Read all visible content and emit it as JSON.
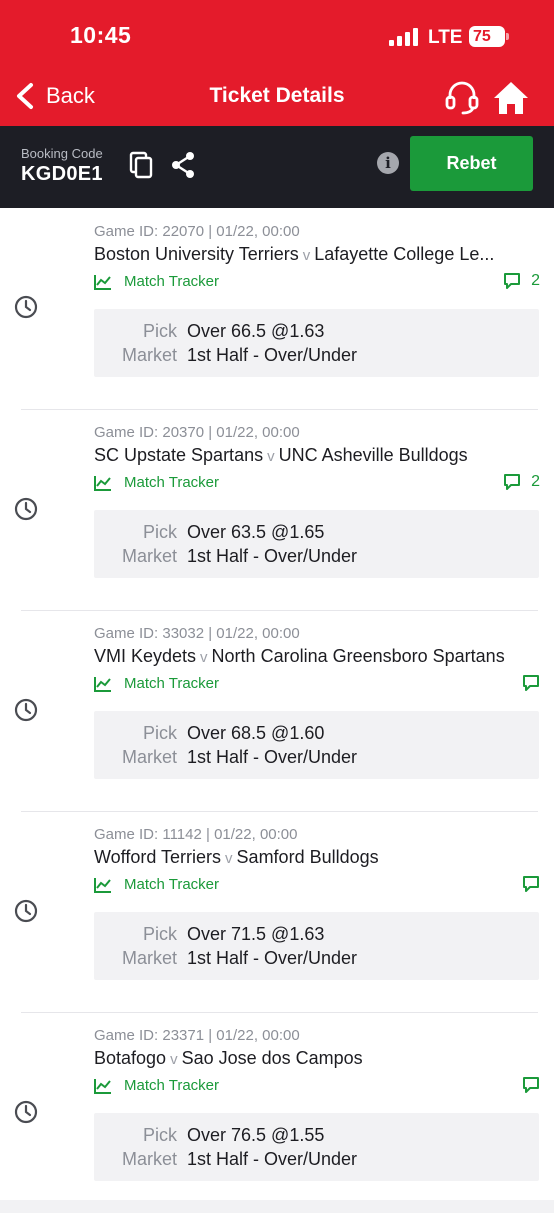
{
  "status": {
    "time": "10:45",
    "network": "LTE",
    "battery": "75"
  },
  "nav": {
    "back_label": "Back",
    "title": "Ticket Details"
  },
  "booking": {
    "label": "Booking Code",
    "code": "KGD0E1",
    "rebet_label": "Rebet"
  },
  "colors": {
    "header_red": "#e41b2b",
    "booking_bar": "#1d1e25",
    "accent_green": "#1b9a3a"
  },
  "games": [
    {
      "meta": "Game ID: 22070 | 01/22, 00:00",
      "home": "Boston University Terriers",
      "vs": "v",
      "away": "Lafayette College Le...",
      "tracker": "Match Tracker",
      "comments": "2",
      "pick_key": "Pick",
      "pick": "Over 66.5 @1.63",
      "market_key": "Market",
      "market": "1st Half - Over/Under"
    },
    {
      "meta": "Game ID: 20370 | 01/22, 00:00",
      "home": "SC Upstate Spartans",
      "vs": "v",
      "away": "UNC Asheville Bulldogs",
      "tracker": "Match Tracker",
      "comments": "2",
      "pick_key": "Pick",
      "pick": "Over 63.5 @1.65",
      "market_key": "Market",
      "market": "1st Half - Over/Under"
    },
    {
      "meta": "Game ID: 33032 | 01/22, 00:00",
      "home": "VMI Keydets",
      "vs": "v",
      "away": "North Carolina Greensboro Spartans",
      "tracker": "Match Tracker",
      "comments": "",
      "pick_key": "Pick",
      "pick": "Over 68.5 @1.60",
      "market_key": "Market",
      "market": "1st Half - Over/Under"
    },
    {
      "meta": "Game ID: 11142 | 01/22, 00:00",
      "home": "Wofford Terriers",
      "vs": "v",
      "away": "Samford Bulldogs",
      "tracker": "Match Tracker",
      "comments": "",
      "pick_key": "Pick",
      "pick": "Over 71.5 @1.63",
      "market_key": "Market",
      "market": "1st Half - Over/Under"
    },
    {
      "meta": "Game ID: 23371 | 01/22, 00:00",
      "home": "Botafogo",
      "vs": "v",
      "away": "Sao Jose dos Campos",
      "tracker": "Match Tracker",
      "comments": "",
      "pick_key": "Pick",
      "pick": "Over 76.5 @1.55",
      "market_key": "Market",
      "market": "1st Half - Over/Under"
    }
  ]
}
